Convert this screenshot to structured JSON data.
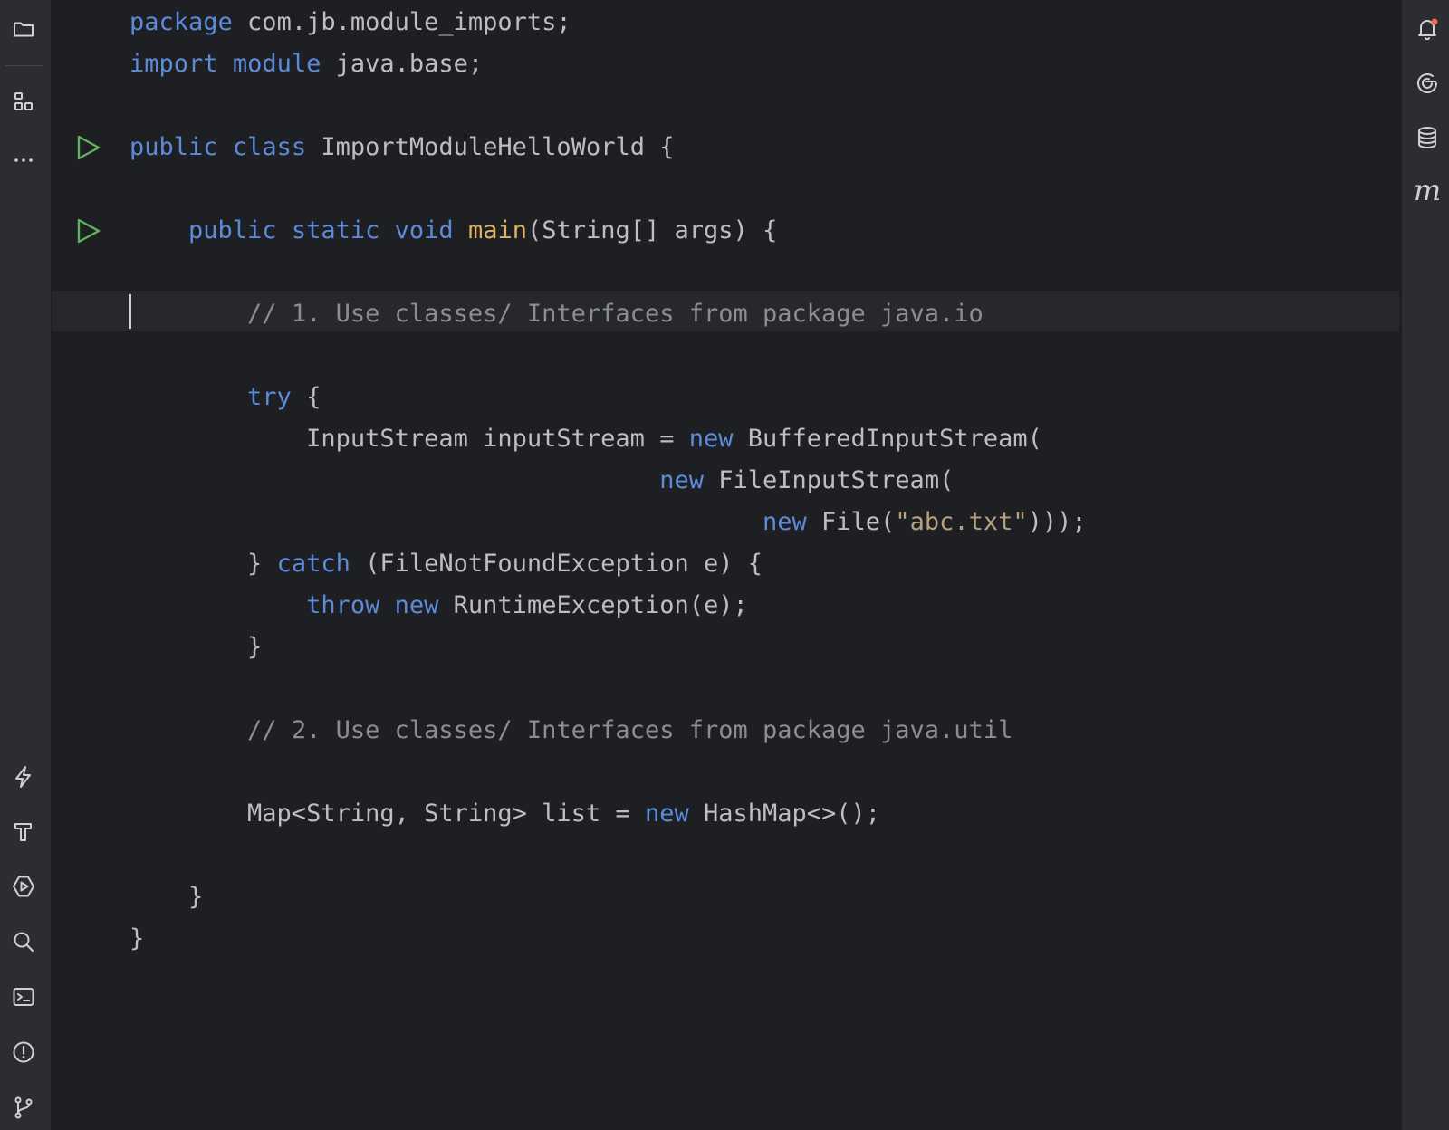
{
  "colors": {
    "background": "#1e1f22",
    "toolbar": "#2b2d30",
    "keyword": "#5d8ad9",
    "function": "#e0b265",
    "string": "#b8a27e",
    "comment": "#8b8d93",
    "text": "#bcbec4",
    "run_icon": "#5fb35f",
    "inspection_ok": "#5fb35f",
    "notification_dot": "#e66d48"
  },
  "left_toolbar": {
    "top": [
      {
        "icon": "folder-icon",
        "name": "project"
      },
      {
        "icon": "structure-icon",
        "name": "structure"
      },
      {
        "icon": "more-icon",
        "name": "more-tool-windows"
      }
    ],
    "bottom": [
      {
        "icon": "lightning-icon",
        "name": "services"
      },
      {
        "icon": "hammer-icon",
        "name": "build"
      },
      {
        "icon": "run-icon",
        "name": "run"
      },
      {
        "icon": "search-icon",
        "name": "find"
      },
      {
        "icon": "terminal-icon",
        "name": "terminal"
      },
      {
        "icon": "problems-icon",
        "name": "problems"
      },
      {
        "icon": "git-branch-icon",
        "name": "git"
      }
    ]
  },
  "right_toolbar": [
    {
      "icon": "bell-icon",
      "name": "notifications",
      "has_badge": true
    },
    {
      "icon": "ai-assistant-icon",
      "name": "ai-assistant"
    },
    {
      "icon": "database-icon",
      "name": "database"
    },
    {
      "icon": "maven-icon",
      "name": "maven",
      "glyph": "m"
    }
  ],
  "editor": {
    "caret_line": 7,
    "lines": [
      {
        "n": 1,
        "tokens": [
          {
            "t": "kw",
            "v": "package"
          },
          {
            "t": "tx",
            "v": " com.jb.module_imports;"
          }
        ]
      },
      {
        "n": 2,
        "tokens": [
          {
            "t": "kw",
            "v": "import"
          },
          {
            "t": "tx",
            "v": " "
          },
          {
            "t": "kw",
            "v": "module"
          },
          {
            "t": "tx",
            "v": " java.base;"
          }
        ]
      },
      {
        "n": 3,
        "tokens": []
      },
      {
        "n": 4,
        "run": true,
        "tokens": [
          {
            "t": "kw",
            "v": "public"
          },
          {
            "t": "tx",
            "v": " "
          },
          {
            "t": "kw",
            "v": "class"
          },
          {
            "t": "tx",
            "v": " ImportModuleHelloWorld {"
          }
        ]
      },
      {
        "n": 5,
        "tokens": []
      },
      {
        "n": 6,
        "run": true,
        "tokens": [
          {
            "t": "tx",
            "v": "    "
          },
          {
            "t": "kw",
            "v": "public"
          },
          {
            "t": "tx",
            "v": " "
          },
          {
            "t": "kw",
            "v": "static"
          },
          {
            "t": "tx",
            "v": " "
          },
          {
            "t": "kw",
            "v": "void"
          },
          {
            "t": "tx",
            "v": " "
          },
          {
            "t": "fn",
            "v": "main"
          },
          {
            "t": "tx",
            "v": "(String[] args) {"
          }
        ]
      },
      {
        "n": 7,
        "tokens": []
      },
      {
        "n": 8,
        "tokens": [
          {
            "t": "tx",
            "v": "        "
          },
          {
            "t": "cm",
            "v": "// 1. Use classes/ Interfaces from package java.io"
          }
        ]
      },
      {
        "n": 9,
        "tokens": []
      },
      {
        "n": 10,
        "tokens": [
          {
            "t": "tx",
            "v": "        "
          },
          {
            "t": "kw",
            "v": "try"
          },
          {
            "t": "tx",
            "v": " {"
          }
        ]
      },
      {
        "n": 11,
        "tokens": [
          {
            "t": "tx",
            "v": "            InputStream inputStream = "
          },
          {
            "t": "kw",
            "v": "new"
          },
          {
            "t": "tx",
            "v": " BufferedInputStream("
          }
        ]
      },
      {
        "n": 12,
        "tokens": [
          {
            "t": "tx",
            "v": "                                    "
          },
          {
            "t": "kw",
            "v": "new"
          },
          {
            "t": "tx",
            "v": " FileInputStream("
          }
        ]
      },
      {
        "n": 13,
        "tokens": [
          {
            "t": "tx",
            "v": "                                           "
          },
          {
            "t": "kw",
            "v": "new"
          },
          {
            "t": "tx",
            "v": " File("
          },
          {
            "t": "str",
            "v": "\"abc.txt\""
          },
          {
            "t": "tx",
            "v": ")));"
          }
        ]
      },
      {
        "n": 14,
        "tokens": [
          {
            "t": "tx",
            "v": "        } "
          },
          {
            "t": "kw",
            "v": "catch"
          },
          {
            "t": "tx",
            "v": " (FileNotFoundException e) {"
          }
        ]
      },
      {
        "n": 15,
        "tokens": [
          {
            "t": "tx",
            "v": "            "
          },
          {
            "t": "kw",
            "v": "throw"
          },
          {
            "t": "tx",
            "v": " "
          },
          {
            "t": "kw",
            "v": "new"
          },
          {
            "t": "tx",
            "v": " RuntimeException(e);"
          }
        ]
      },
      {
        "n": 16,
        "tokens": [
          {
            "t": "tx",
            "v": "        }"
          }
        ]
      },
      {
        "n": 17,
        "tokens": []
      },
      {
        "n": 18,
        "tokens": [
          {
            "t": "tx",
            "v": "        "
          },
          {
            "t": "cm",
            "v": "// 2. Use classes/ Interfaces from package java.util"
          }
        ]
      },
      {
        "n": 19,
        "tokens": []
      },
      {
        "n": 20,
        "tokens": [
          {
            "t": "tx",
            "v": "        Map<String, String> list = "
          },
          {
            "t": "kw",
            "v": "new"
          },
          {
            "t": "tx",
            "v": " HashMap<>();"
          }
        ]
      },
      {
        "n": 21,
        "tokens": []
      },
      {
        "n": 22,
        "tokens": [
          {
            "t": "tx",
            "v": "    }"
          }
        ]
      },
      {
        "n": 23,
        "tokens": [
          {
            "t": "tx",
            "v": "}"
          }
        ]
      }
    ]
  }
}
